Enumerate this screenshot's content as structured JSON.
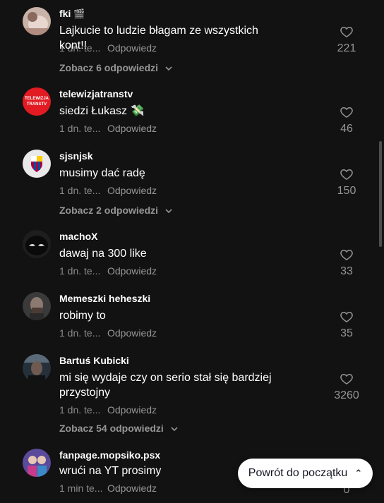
{
  "comments": [
    {
      "username": "fki",
      "badge": "🎬",
      "text": "Lajkucie to ludzie błagam ze wszystkich kont!!",
      "time": "1 dn. te...",
      "reply": "Odpowiedz",
      "likes": "221",
      "view_replies": "Zobacz 6 odpowiedzi",
      "avatar_icon": "avatar-photo-icon"
    },
    {
      "username": "telewizjatranstv",
      "text": "siedzi Łukasz 💸",
      "time": "1 dn. te...",
      "reply": "Odpowiedz",
      "likes": "46",
      "avatar_icon": "telewizja-logo-icon"
    },
    {
      "username": "sjsnjsk",
      "text": "musimy dać radę",
      "time": "1 dn. te...",
      "reply": "Odpowiedz",
      "likes": "150",
      "view_replies": "Zobacz 2 odpowiedzi",
      "avatar_icon": "club-crest-icon"
    },
    {
      "username": "machoX",
      "text": "dawaj na 300 like",
      "time": "1 dn. te...",
      "reply": "Odpowiedz",
      "likes": "33",
      "avatar_icon": "masked-face-icon"
    },
    {
      "username": "Memeszki heheszki",
      "text": "robimy to",
      "time": "1 dn. te...",
      "reply": "Odpowiedz",
      "likes": "35",
      "avatar_icon": "man-portrait-icon"
    },
    {
      "username": "Bartuś Kubicki",
      "text": "mi się wydaje czy on serio stał się bardziej przystojny",
      "time": "1 dn. te...",
      "reply": "Odpowiedz",
      "likes": "3260",
      "view_replies": "Zobacz 54 odpowiedzi",
      "avatar_icon": "dark-portrait-icon"
    },
    {
      "username": "fanpage.mopsiko.psx",
      "text": "wrući na YT prosimy",
      "time": "1 min te...",
      "reply": "Odpowiedz",
      "likes": "0",
      "avatar_icon": "two-people-icon"
    }
  ],
  "back_to_top": {
    "label": "Powrót do początku",
    "icon": "double-chevron-up-icon"
  },
  "colors": {
    "background": "#121212",
    "text_primary": "#ffffff",
    "text_secondary": "rgba(255,255,255,0.5)",
    "button_bg": "#ffffff"
  }
}
